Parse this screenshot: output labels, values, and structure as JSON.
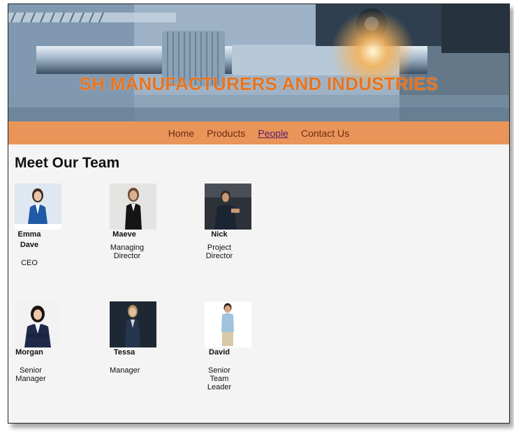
{
  "header": {
    "title": "SH MANUFACTURERS AND INDUSTRIES"
  },
  "nav": {
    "items": [
      {
        "label": "Home",
        "active": false
      },
      {
        "label": "Products",
        "active": false
      },
      {
        "label": "People",
        "active": true
      },
      {
        "label": "Contact Us",
        "active": false
      }
    ]
  },
  "main": {
    "heading": "Meet Our Team",
    "members": [
      {
        "name": "Emma Dave",
        "role": "CEO"
      },
      {
        "name": "Maeve",
        "role": "Managing Director"
      },
      {
        "name": "Nick",
        "role": "Project Director"
      },
      {
        "name": "Morgan",
        "role": "Senior Manager"
      },
      {
        "name": "Tessa",
        "role": "Manager"
      },
      {
        "name": "David",
        "role": "Senior Team Leader"
      }
    ]
  },
  "colors": {
    "accent": "#e8741e",
    "nav_bg": "#e9955a",
    "nav_text": "#6e2a10",
    "page_bg": "#f4f4f4"
  }
}
